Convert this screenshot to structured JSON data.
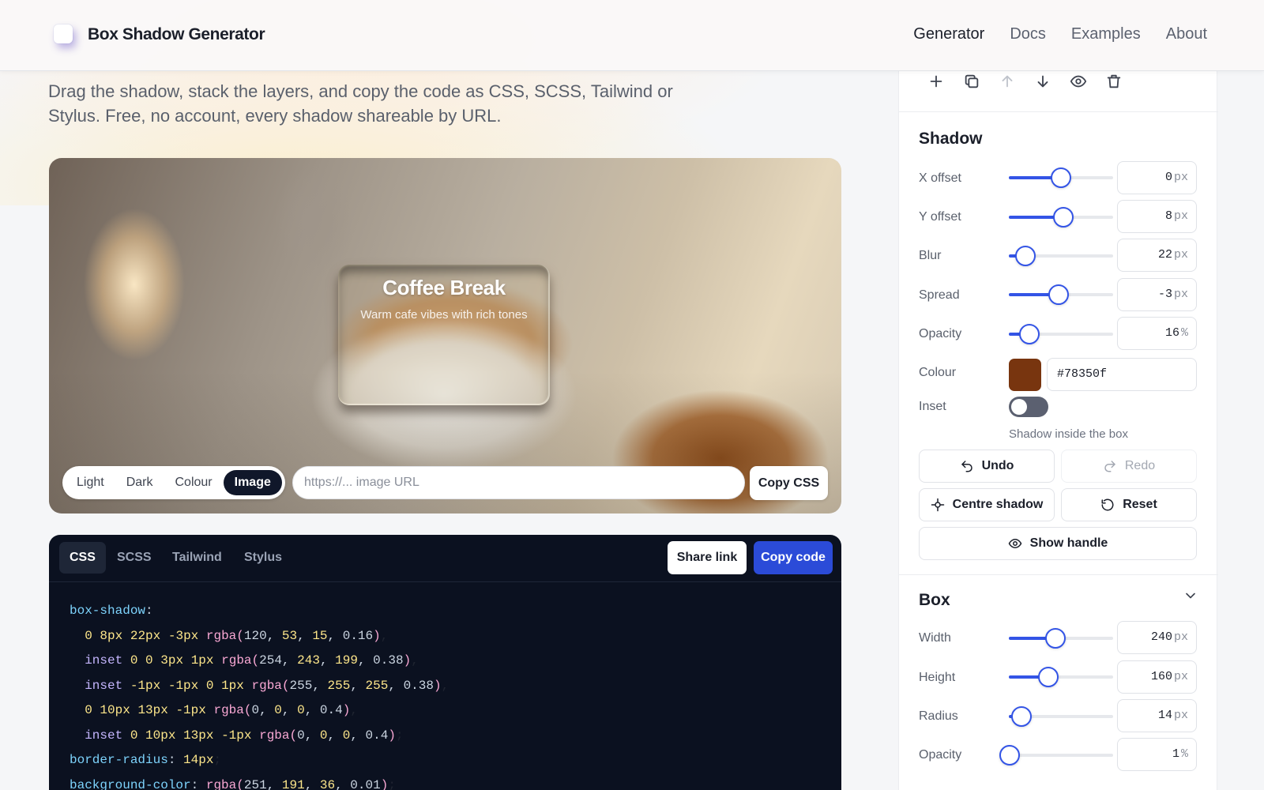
{
  "header": {
    "brand": "Box Shadow Generator",
    "nav": [
      "Generator",
      "Docs",
      "Examples",
      "About"
    ],
    "active_nav": "Generator"
  },
  "tagline": "Drag the shadow, stack the layers, and copy the code as CSS, SCSS, Tailwind or Stylus. Free, no account, every shadow shareable by URL.",
  "preview": {
    "card_title": "Coffee Break",
    "card_subtitle": "Warm cafe vibes with rich tones",
    "bg_modes": [
      "Light",
      "Dark",
      "Colour",
      "Image"
    ],
    "active_bg_mode": "Image",
    "url_placeholder": "https://... image URL",
    "copy_css_label": "Copy CSS"
  },
  "code": {
    "tabs": [
      "CSS",
      "SCSS",
      "Tailwind",
      "Stylus"
    ],
    "active_tab": "CSS",
    "share_label": "Share link",
    "copy_label": "Copy code",
    "lines": [
      "box-shadow:",
      "  0 8px 22px -3px rgba(120, 53, 15, 0.16),",
      "  inset 0 0 3px 1px rgba(254, 243, 199, 0.38),",
      "  inset -1px -1px 0 1px rgba(255, 255, 255, 0.38),",
      "  0 10px 13px -1px rgba(0, 0, 0, 0.4),",
      "  inset 0 10px 13px -1px rgba(0, 0, 0, 0.4);",
      "border-radius: 14px;",
      "background-color: rgba(251, 191, 36, 0.01);"
    ]
  },
  "layer_toolbar": {
    "icons": [
      "plus-icon",
      "duplicate-icon",
      "arrow-up-icon",
      "arrow-down-icon",
      "eye-icon",
      "trash-icon"
    ]
  },
  "shadow": {
    "title": "Shadow",
    "x_offset": {
      "label": "X offset",
      "value": "0",
      "unit": "px",
      "fraction": 0.5
    },
    "y_offset": {
      "label": "Y offset",
      "value": "8",
      "unit": "px",
      "fraction": 0.52
    },
    "blur": {
      "label": "Blur",
      "value": "22",
      "unit": "px",
      "fraction": 0.16
    },
    "spread": {
      "label": "Spread",
      "value": "-3",
      "unit": "px",
      "fraction": 0.48
    },
    "opacity": {
      "label": "Opacity",
      "value": "16",
      "unit": "%",
      "fraction": 0.2
    },
    "colour_label": "Colour",
    "colour_value": "#78350f",
    "inset_label": "Inset",
    "inset_hint": "Shadow inside the box",
    "undo_label": "Undo",
    "redo_label": "Redo",
    "centre_label": "Centre shadow",
    "reset_label": "Reset",
    "show_handle_label": "Show handle"
  },
  "box": {
    "title": "Box",
    "width": {
      "label": "Width",
      "value": "240",
      "unit": "px",
      "fraction": 0.45
    },
    "height": {
      "label": "Height",
      "value": "160",
      "unit": "px",
      "fraction": 0.38
    },
    "radius": {
      "label": "Radius",
      "value": "14",
      "unit": "px",
      "fraction": 0.12
    },
    "opacity": {
      "label": "Opacity",
      "value": "1",
      "unit": "%",
      "fraction": 0.01
    }
  },
  "colors": {
    "accent": "#3354e6",
    "copy_code_bg": "#2b4bd8",
    "code_bg": "#0b1120",
    "shadow_colour": "#78350f"
  }
}
